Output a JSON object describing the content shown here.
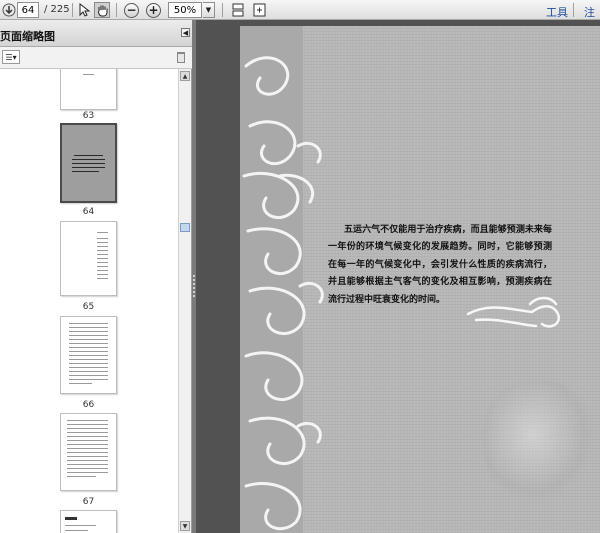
{
  "toolbar": {
    "current_page": "64",
    "total_pages": "/ 225",
    "zoom": "50%",
    "tools_label": "工具",
    "comment_label": "注释"
  },
  "panel": {
    "title": "页面缩略图"
  },
  "thumbnails": [
    {
      "label": "63",
      "selected": false
    },
    {
      "label": "64",
      "selected": true
    },
    {
      "label": "65",
      "selected": false
    },
    {
      "label": "66",
      "selected": false
    },
    {
      "label": "67",
      "selected": false
    }
  ],
  "page": {
    "paragraph": "五运六气不仅能用于治疗疾病，而且能够预测未来每一年份的环境气候变化的发展趋势。同时，它能够预测在每一年的气候变化中，会引发什么性质的疾病流行，并且能够根据主气客气的变化及相互影响，预测疾病在流行过程中旺衰变化的时间。"
  }
}
